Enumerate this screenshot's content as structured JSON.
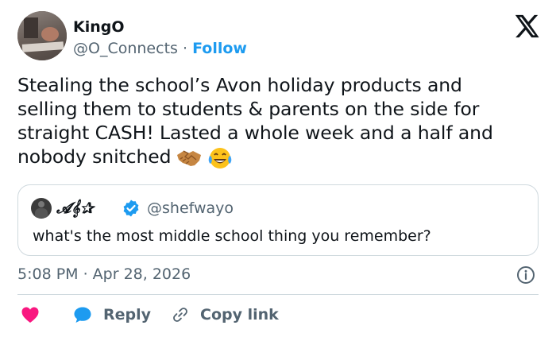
{
  "author": {
    "name": "KingO",
    "handle": "@O_Connects",
    "separator": "·",
    "follow_label": "Follow"
  },
  "tweet": {
    "lines": [
      "Stealing the school’s Avon holiday products and",
      "selling them to students & parents on the side for",
      "straight CASH! Lasted a whole week and a half and",
      "nobody snitched"
    ],
    "emojis": [
      "handshake-emoji",
      "tears-of-joy-emoji"
    ]
  },
  "quote": {
    "name": "𝓐𝄞✰",
    "handle": "@shefwayo",
    "text": "what's the most middle school thing you remember?"
  },
  "meta": {
    "timestamp": "5:08 PM · Apr 28, 2026"
  },
  "actions": {
    "reply_label": "Reply",
    "copy_link_label": "Copy link"
  },
  "colors": {
    "accent": "#1d9bf0",
    "like": "#f91880",
    "secondary_text": "#536471",
    "border": "#cfd9de"
  }
}
